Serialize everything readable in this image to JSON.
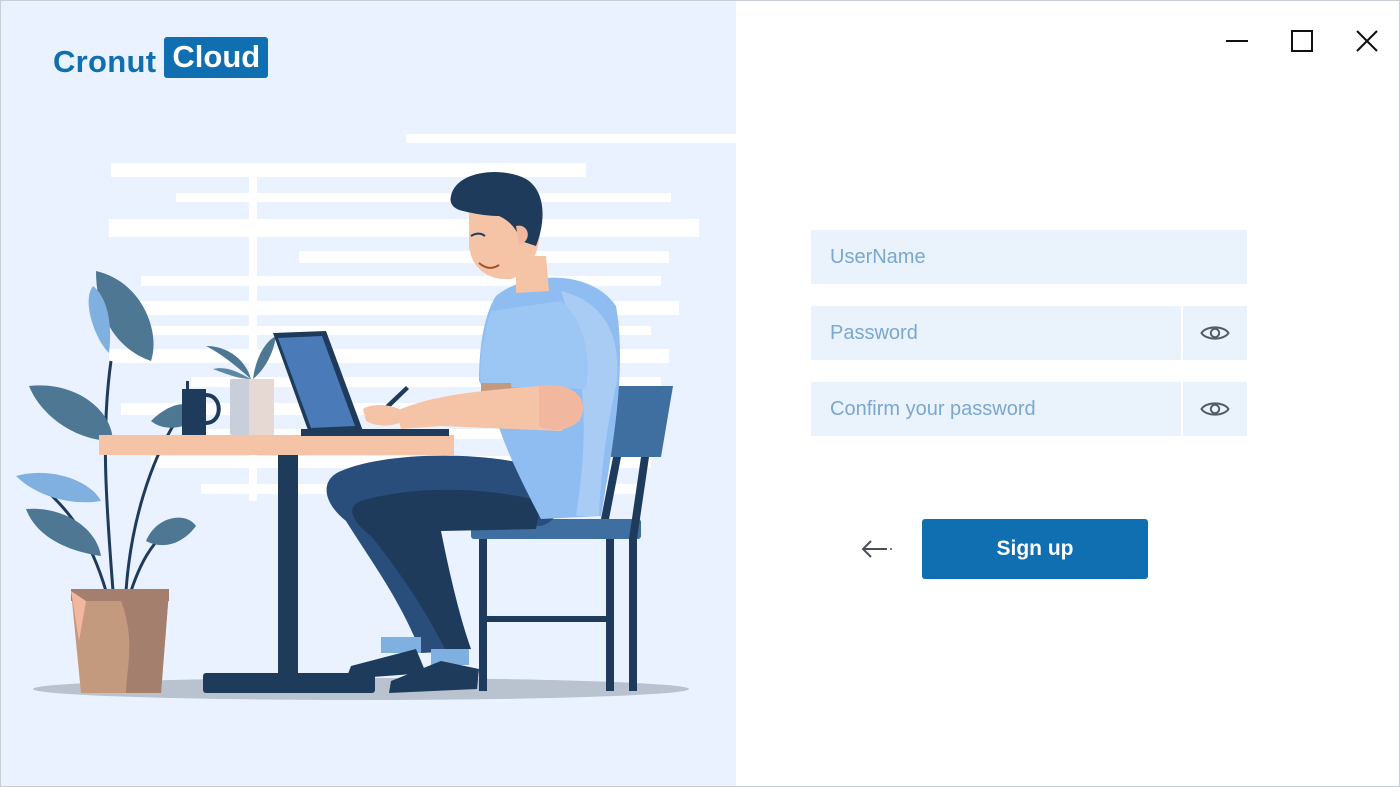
{
  "brand": {
    "word1": "Cronut",
    "word2": "Cloud",
    "color": "#0f6fb0"
  },
  "window_controls": {
    "minimize_icon": "minimize-icon",
    "maximize_icon": "maximize-icon",
    "close_icon": "close-icon"
  },
  "form": {
    "username": {
      "placeholder": "UserName",
      "value": ""
    },
    "password": {
      "placeholder": "Password",
      "value": "",
      "toggle_icon": "eye-icon"
    },
    "confirm_password": {
      "placeholder": "Confirm your password",
      "value": "",
      "toggle_icon": "eye-icon"
    },
    "back_icon": "arrow-left-icon",
    "submit_label": "Sign up"
  },
  "colors": {
    "accent": "#0f6fb0",
    "left_panel_bg": "#eaf2ff",
    "field_bg": "#eaf2fb",
    "placeholder": "#7aa8cf"
  }
}
